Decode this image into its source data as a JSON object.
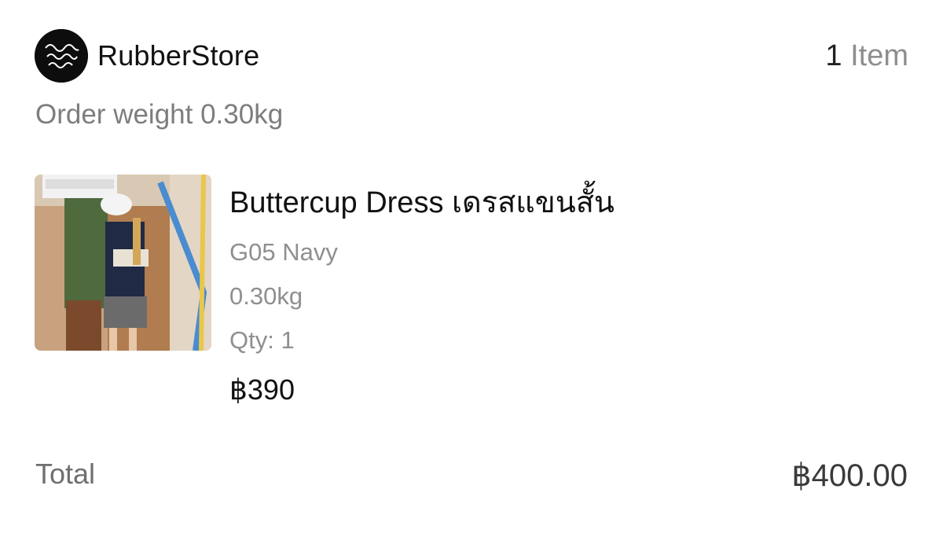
{
  "store": {
    "logo_icon": "rubberstore-brand-logo",
    "logo_text": "Rubber store Brand",
    "name": "RubberStore",
    "item_count": "1",
    "item_word": "Item"
  },
  "order": {
    "weight_text": "Order weight 0.30kg"
  },
  "product": {
    "image_icon": "product-photo",
    "title": "Buttercup Dress เดรสแขนสั้น",
    "variant": "G05 Navy",
    "weight": "0.30kg",
    "qty": "Qty: 1",
    "price": "฿390"
  },
  "total": {
    "label": "Total",
    "value": "฿400.00"
  },
  "colors": {
    "primary_text": "#111111",
    "secondary_text": "#8e8e8e",
    "background": "#ffffff"
  }
}
